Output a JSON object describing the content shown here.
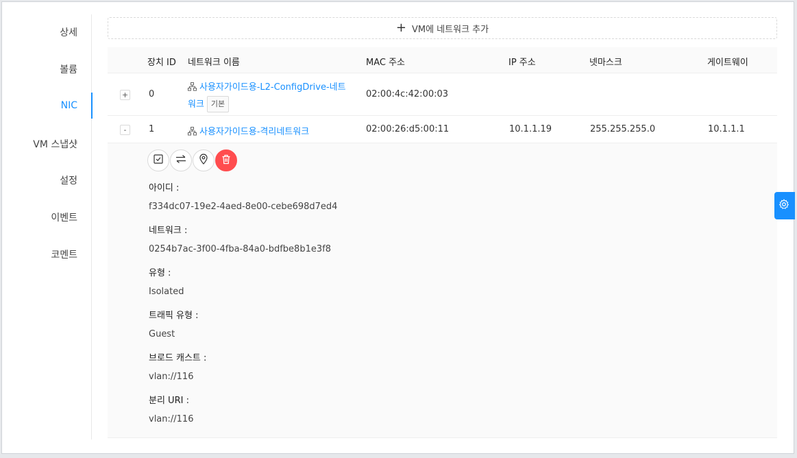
{
  "sidebar": {
    "items": [
      {
        "label": "상세"
      },
      {
        "label": "볼륨"
      },
      {
        "label": "NIC"
      },
      {
        "label": "VM 스냅샷"
      },
      {
        "label": "설정"
      },
      {
        "label": "이벤트"
      },
      {
        "label": "코멘트"
      }
    ],
    "active": "NIC"
  },
  "add_button": {
    "label": "VM에 네트워크 추가"
  },
  "table": {
    "columns": [
      "장치 ID",
      "네트워크 이름",
      "MAC 주소",
      "IP 주소",
      "넷마스크",
      "게이트웨이"
    ],
    "rows": [
      {
        "expander": "+",
        "device_id": "0",
        "network_name_line1": "사용자가이드용-L2-ConfigDrive-네트",
        "network_name_line2": "워크",
        "tag": "기본",
        "mac": "02:00:4c:42:00:03",
        "ip": "",
        "netmask": "",
        "gateway": ""
      },
      {
        "expander": "-",
        "device_id": "1",
        "network_name": "사용자가이드용-격리네트워크",
        "mac": "02:00:26:d5:00:11",
        "ip": "10.1.1.19",
        "netmask": "255.255.255.0",
        "gateway": "10.1.1.1"
      }
    ]
  },
  "detail": {
    "actions": [
      {
        "icon": "checkbox-icon"
      },
      {
        "icon": "swap-icon"
      },
      {
        "icon": "location-pin-icon"
      },
      {
        "icon": "delete-icon",
        "color": "#ff4d4f"
      }
    ],
    "fields": [
      {
        "label": "아이디 :",
        "value": "f334dc07-19e2-4aed-8e00-cebe698d7ed4"
      },
      {
        "label": "네트워크 :",
        "value": "0254b7ac-3f00-4fba-84a0-bdfbe8b1e3f8"
      },
      {
        "label": "유형 :",
        "value": "Isolated"
      },
      {
        "label": "트래픽 유형 :",
        "value": "Guest"
      },
      {
        "label": "브로드 캐스트 :",
        "value": "vlan://116"
      },
      {
        "label": "분리 URI :",
        "value": "vlan://116"
      }
    ]
  },
  "settings_tab": {
    "icon": "gear-icon",
    "color": "#1890ff"
  },
  "colors": {
    "accent": "#1890ff",
    "danger": "#ff4d4f"
  }
}
